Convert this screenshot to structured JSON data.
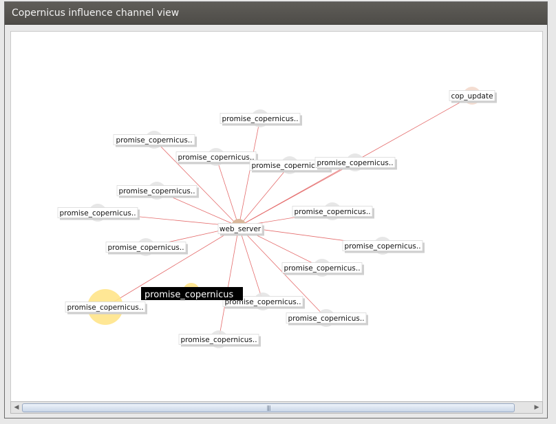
{
  "window": {
    "title": "Copernicus influence channel view"
  },
  "graph": {
    "center_node": "web_server",
    "highlighted_label": "promise_copernicus",
    "nodes": [
      "cop_update",
      "promise_copernicus..",
      "promise_copernicus..",
      "promise_copernicus..",
      "promise_copernicus..",
      "promise_copernicus..",
      "promise_copernicus..",
      "promise_copernicus..",
      "promise_copernicus..",
      "promise_copernicus..",
      "promise_copernicus..",
      "promise_copernicus..",
      "promise_copernicus..",
      "promise_copernicus..",
      "promise_copernicus..",
      "promise_copernicus.."
    ],
    "node_colors": {
      "default": "#e4e4e4",
      "center": "#d9b79a",
      "cop_update": "#f3d9cc",
      "highlight": "#ffe48a"
    },
    "edge_color": "#e46b6b"
  },
  "scrollbar": {
    "left_arrow": "◀",
    "right_arrow": "▶",
    "grip": "|||"
  }
}
